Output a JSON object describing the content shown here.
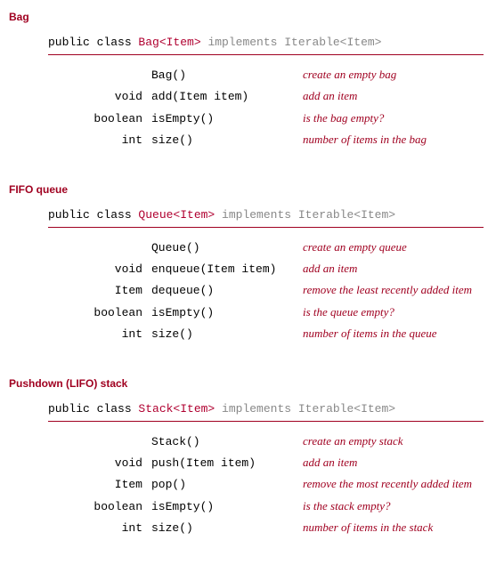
{
  "sections": [
    {
      "title": "Bag",
      "keyword": "public class ",
      "classname": "Bag<Item>",
      "implements": " implements Iterable<Item>",
      "rows": [
        {
          "ret": "",
          "method": "Bag()",
          "desc": "create an empty bag"
        },
        {
          "ret": "void",
          "method": "add(Item item)",
          "desc": "add an item"
        },
        {
          "ret": "boolean",
          "method": "isEmpty()",
          "desc": "is the bag empty?"
        },
        {
          "ret": "int",
          "method": "size()",
          "desc": "number of items in the bag"
        }
      ]
    },
    {
      "title": "FIFO queue",
      "keyword": "public class ",
      "classname": "Queue<Item>",
      "implements": " implements Iterable<Item>",
      "rows": [
        {
          "ret": "",
          "method": "Queue()",
          "desc": "create an empty queue"
        },
        {
          "ret": "void",
          "method": "enqueue(Item item)",
          "desc": "add an item"
        },
        {
          "ret": "Item",
          "method": "dequeue()",
          "desc": "remove the least recently added item"
        },
        {
          "ret": "boolean",
          "method": "isEmpty()",
          "desc": "is the queue empty?"
        },
        {
          "ret": "int",
          "method": "size()",
          "desc": "number of items in the queue"
        }
      ]
    },
    {
      "title": "Pushdown (LIFO) stack",
      "keyword": "public class ",
      "classname": "Stack<Item>",
      "implements": " implements Iterable<Item>",
      "rows": [
        {
          "ret": "",
          "method": "Stack()",
          "desc": "create an empty stack"
        },
        {
          "ret": "void",
          "method": "push(Item item)",
          "desc": "add an item"
        },
        {
          "ret": "Item",
          "method": "pop()",
          "desc": "remove the most recently added item"
        },
        {
          "ret": "boolean",
          "method": "isEmpty()",
          "desc": "is the stack empty?"
        },
        {
          "ret": "int",
          "method": "size()",
          "desc": "number of items in the stack"
        }
      ]
    }
  ]
}
